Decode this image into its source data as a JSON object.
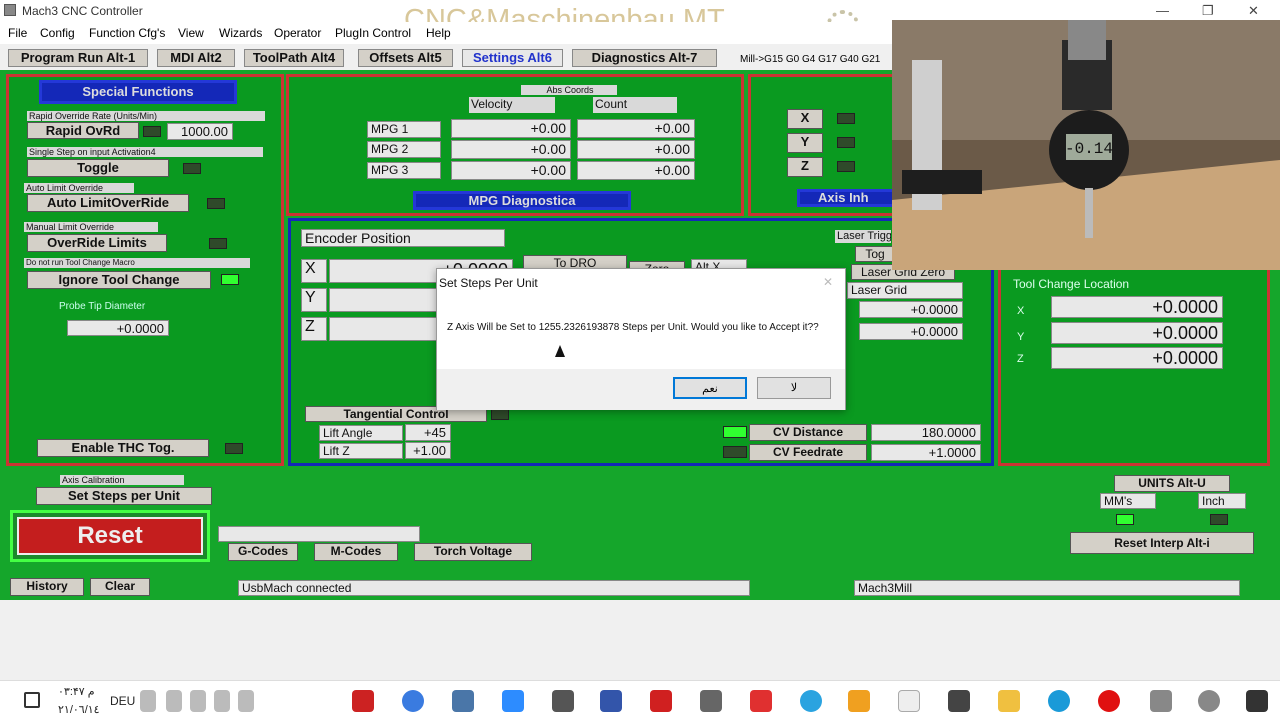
{
  "window": {
    "title": "Mach3 CNC Controller",
    "min": "—",
    "max": "❐",
    "close": "✕"
  },
  "watermark": "CNC&Maschinenbau MT",
  "menu": [
    "File",
    "Config",
    "Function Cfg's",
    "View",
    "Wizards",
    "Operator",
    "PlugIn Control",
    "Help"
  ],
  "tabs": [
    "Program Run Alt-1",
    "MDI Alt2",
    "ToolPath Alt4",
    "Offsets Alt5",
    "Settings Alt6",
    "Diagnostics Alt-7"
  ],
  "modeline": "Mill->G15  G0 G4 G17 G40 G21",
  "special": {
    "title": "Special Functions",
    "rapid_lbl": "Rapid Override Rate (Units/Min)",
    "rapid_btn": "Rapid OvRd",
    "rapid_val": "1000.00",
    "single_lbl": "Single Step on input Activation4",
    "toggle_btn": "Toggle",
    "autolimit_lbl": "Auto Limit Override",
    "autolimit_btn": "Auto LimitOverRide",
    "manual_lbl": "Manual Limit Override",
    "override_btn": "OverRide Limits",
    "notool_lbl": "Do not run Tool Change Macro",
    "ignore_btn": "Ignore Tool Change",
    "probe_lbl": "Probe Tip Diameter",
    "probe_val": "+0.0000",
    "thc_btn": "Enable THC Tog."
  },
  "mpg": {
    "abs": "Abs Coords",
    "velocity": "Velocity",
    "count": "Count",
    "rows": [
      {
        "name": "MPG 1",
        "vel": "+0.00",
        "cnt": "+0.00"
      },
      {
        "name": "MPG 2",
        "vel": "+0.00",
        "cnt": "+0.00"
      },
      {
        "name": "MPG 3",
        "vel": "+0.00",
        "cnt": "+0.00"
      }
    ],
    "title": "MPG Diagnostica"
  },
  "axis": {
    "x": "X",
    "y": "Y",
    "z": "Z",
    "title": "Axis Inh"
  },
  "encoder": {
    "title": "Encoder Position",
    "x": "X",
    "y": "Y",
    "z": "Z",
    "xval": "+0.0000",
    "to_dro": "To DRO",
    "zero": "Zero",
    "altx": "Alt X"
  },
  "laser": {
    "trig": "Laser Trigg",
    "tog": "Tog",
    "grid_zero": "Laser Grid Zero",
    "grid": "Laser Grid",
    "v1": "+0.0000",
    "v2": "+0.0000"
  },
  "tangent": {
    "btn": "Tangential Control",
    "lift_angle": "Lift Angle",
    "lift_angle_val": "+45",
    "lift_z": "Lift Z",
    "lift_z_val": "+1.00"
  },
  "cv": {
    "dist_btn": "CV Distance",
    "dist_val": "180.0000",
    "feed_btn": "CV Feedrate",
    "feed_val": "+1.0000"
  },
  "toolchange": {
    "title": "Tool Change Location",
    "x": "X",
    "y": "Y",
    "z": "Z",
    "xv": "+0.0000",
    "yv": "+0.0000",
    "zv": "+0.0000"
  },
  "calib": {
    "lbl": "Axis Calibration",
    "btn": "Set Steps per Unit"
  },
  "reset": "Reset",
  "codes": [
    "G-Codes",
    "M-Codes",
    "Torch Voltage"
  ],
  "units": {
    "btn": "UNITS Alt-U",
    "mm": "MM's",
    "inch": "Inch",
    "reset_interp": "Reset Interp Alt-i"
  },
  "history": "History",
  "clear": "Clear",
  "status": "UsbMach connected",
  "profile": "Mach3Mill",
  "dialog": {
    "title": "Set Steps Per Unit",
    "msg": "Z Axis Will be Set to 1255.2326193878 Steps per Unit. Would you like to Accept it??",
    "yes": "نعم",
    "no": "لا",
    "close": "✕"
  },
  "video": {
    "display": "-0.14"
  },
  "taskbar": {
    "time": "۰۳:۴۷ م",
    "date": "۲۱/۰٦/۱٤",
    "lang": "DEU"
  }
}
